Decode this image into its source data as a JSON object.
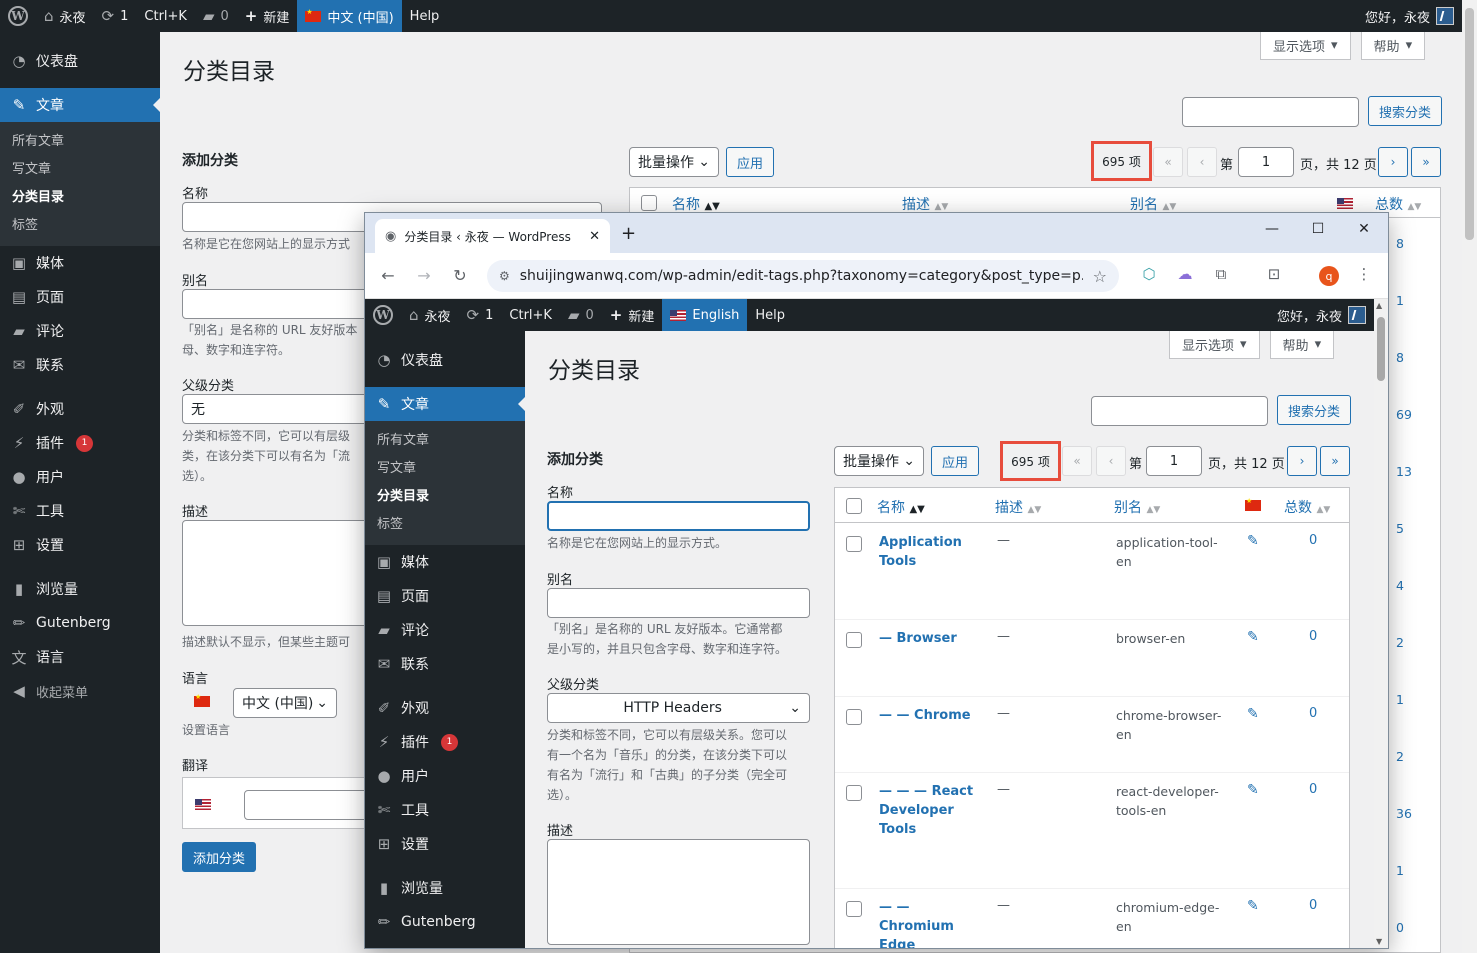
{
  "outer": {
    "adminbar": {
      "site_name": "永夜",
      "updates": "1",
      "shortcut": "Ctrl+K",
      "comments": "0",
      "new_label": "新建",
      "language": "中文 (中国)",
      "help": "Help",
      "greeting": "您好，永夜"
    },
    "menu": {
      "dashboard": "仪表盘",
      "posts": "文章",
      "sub_all": "所有文章",
      "sub_new": "写文章",
      "sub_categories": "分类目录",
      "sub_tags": "标签",
      "media": "媒体",
      "pages": "页面",
      "comments": "评论",
      "contact": "联系",
      "appearance": "外观",
      "plugins": "插件",
      "plugins_badge": "1",
      "users": "用户",
      "tools": "工具",
      "settings": "设置",
      "views": "浏览量",
      "gutenberg": "Gutenberg",
      "language": "语言",
      "collapse": "收起菜单"
    },
    "screen_options": "显示选项",
    "help_tab": "帮助",
    "page_title": "分类目录",
    "search_button": "搜索分类",
    "form": {
      "heading": "添加分类",
      "name_label": "名称",
      "name_help": "名称是它在您网站上的显示方式",
      "slug_label": "别名",
      "slug_help_1": "「别名」是名称的 URL 友好版本",
      "slug_help_2": "母、数字和连字符。",
      "parent_label": "父级分类",
      "parent_value": "无",
      "parent_help_1": "分类和标签不同，它可以有层级",
      "parent_help_2": "类，在该分类下可以有名为「流",
      "parent_help_3": "选）。",
      "desc_label": "描述",
      "desc_help": "描述默认不显示，但某些主题可",
      "lang_label": "语言",
      "lang_value": "中文 (中国)",
      "lang_help": "设置语言",
      "trans_label": "翻译",
      "submit": "添加分类"
    },
    "bulk": {
      "action": "批量操作",
      "apply": "应用",
      "count": "695 项",
      "first": "«",
      "prev": "‹",
      "page_prefix": "第",
      "page_value": "1",
      "page_suffix": "页，共 12 页",
      "next": "›",
      "last": "»"
    },
    "table": {
      "col_name": "名称",
      "col_desc": "描述",
      "col_slug": "别名",
      "col_count": "总数",
      "counts": [
        "8",
        "1",
        "8",
        "69",
        "13",
        "5",
        "4",
        "2",
        "1",
        "2",
        "36",
        "1",
        "0"
      ]
    }
  },
  "browser": {
    "tab_title": "分类目录 ‹ 永夜 — WordPress",
    "url": "shuijingwanwq.com/wp-admin/edit-tags.php?taxonomy=category&post_type=p...",
    "profile_initial": "q",
    "inner": {
      "adminbar": {
        "site_name": "永夜",
        "updates": "1",
        "shortcut": "Ctrl+K",
        "comments": "0",
        "new_label": "新建",
        "language": "English",
        "help": "Help",
        "greeting": "您好，永夜"
      },
      "menu": {
        "dashboard": "仪表盘",
        "posts": "文章",
        "sub_all": "所有文章",
        "sub_new": "写文章",
        "sub_categories": "分类目录",
        "sub_tags": "标签",
        "media": "媒体",
        "pages": "页面",
        "comments": "评论",
        "contact": "联系",
        "appearance": "外观",
        "plugins": "插件",
        "plugins_badge": "1",
        "users": "用户",
        "tools": "工具",
        "settings": "设置",
        "views": "浏览量",
        "gutenberg": "Gutenberg"
      },
      "screen_options": "显示选项",
      "help_tab": "帮助",
      "page_title": "分类目录",
      "search_button": "搜索分类",
      "form": {
        "heading": "添加分类",
        "name_label": "名称",
        "name_help": "名称是它在您网站上的显示方式。",
        "slug_label": "别名",
        "slug_help_1": "「别名」是名称的 URL 友好版本。它通常都",
        "slug_help_2": "是小写的，并且只包含字母、数字和连字符。",
        "parent_label": "父级分类",
        "parent_value": "HTTP Headers",
        "parent_help_1": "分类和标签不同，它可以有层级关系。您可以",
        "parent_help_2": "有一个名为「音乐」的分类，在该分类下可以",
        "parent_help_3": "有名为「流行」和「古典」的子分类（完全可",
        "parent_help_4": "选）。",
        "desc_label": "描述"
      },
      "bulk": {
        "action": "批量操作",
        "apply": "应用",
        "count": "695 项",
        "first": "«",
        "prev": "‹",
        "page_prefix": "第",
        "page_value": "1",
        "page_suffix": "页，共 12 页",
        "next": "›",
        "last": "»"
      },
      "table": {
        "col_name": "名称",
        "col_desc": "描述",
        "col_slug": "别名",
        "col_count": "总数",
        "rows": [
          {
            "name_1": "Application",
            "name_2": "Tools",
            "name_3": "",
            "desc": "—",
            "slug_1": "application-tool-",
            "slug_2": "en",
            "count": "0"
          },
          {
            "name_1": "— Browser",
            "name_2": "",
            "name_3": "",
            "desc": "—",
            "slug_1": "browser-en",
            "slug_2": "",
            "count": "0"
          },
          {
            "name_1": "— — Chrome",
            "name_2": "",
            "name_3": "",
            "desc": "—",
            "slug_1": "chrome-browser-",
            "slug_2": "en",
            "count": "0"
          },
          {
            "name_1": "— — — React",
            "name_2": "Developer",
            "name_3": "Tools",
            "desc": "—",
            "slug_1": "react-developer-",
            "slug_2": "tools-en",
            "count": "0"
          },
          {
            "name_1": "— —",
            "name_2": "Chromium",
            "name_3": "Edge",
            "desc": "—",
            "slug_1": "chromium-edge-",
            "slug_2": "en",
            "count": "0"
          }
        ]
      }
    }
  },
  "colors": {
    "admin_dark": "#1d2327",
    "accent": "#2271b1",
    "highlight_box": "#e74c3c",
    "badge": "#d63638"
  }
}
